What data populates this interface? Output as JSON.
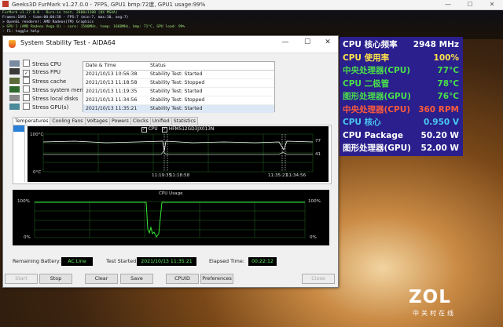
{
  "furmark": {
    "title": "Geeks3D FurMark v1.27.0.0 - 7FPS, GPU1 bmp:72度, GPU1 usage:99%",
    "controls": [
      "—",
      "☐",
      "✕"
    ],
    "osd": [
      "FurMark v1.27.0.0 - Burn-in test, 2800x1100 (8X MSAA)",
      "Frames:1891 - time:00:04:58 - FPS:7 (min:7, max:10, avg:7)",
      "> OpenGL renderer: AMD Radeon(TM) Graphics",
      "> GPU 1 (AMD Radeon Vega 8) - core: 1500MHz, temp: 1668MHz, bmp: 71°C, GPU load: 99%",
      "- F1: toggle help"
    ]
  },
  "aida": {
    "title": "System Stability Test - AIDA64",
    "window_controls": [
      "—",
      "☐",
      "✕"
    ],
    "stress_options": [
      {
        "label": "Stress CPU",
        "checked": false
      },
      {
        "label": "Stress FPU",
        "checked": true
      },
      {
        "label": "Stress cache",
        "checked": false
      },
      {
        "label": "Stress system memory",
        "checked": false
      },
      {
        "label": "Stress local disks",
        "checked": false
      },
      {
        "label": "Stress GPU(s)",
        "checked": false
      }
    ],
    "log": {
      "headers": [
        "Date & Time",
        "Status"
      ],
      "rows": [
        [
          "2021/10/13 10:56:38",
          "Stability Test: Started"
        ],
        [
          "2021/10/13 11:18:58",
          "Stability Test: Stopped"
        ],
        [
          "2021/10/13 11:19:35",
          "Stability Test: Started"
        ],
        [
          "2021/10/13 11:34:56",
          "Stability Test: Stopped"
        ],
        [
          "2021/10/13 11:35:21",
          "Stability Test: Started"
        ]
      ]
    },
    "tabs": [
      "Temperatures",
      "Cooling Fans",
      "Voltages",
      "Powers",
      "Clocks",
      "Unified",
      "Statistics"
    ],
    "active_tab": "Temperatures",
    "temp_chart": {
      "legend": [
        "CPU",
        "HFM512GD3JX013N"
      ],
      "y_top": "100°C",
      "y_bottom": "0°C",
      "time_labels": [
        "11:19:35",
        "11:18:58",
        "11:35:21",
        "11:34:56"
      ],
      "readout_values": [
        "77",
        "41"
      ]
    },
    "usage_chart": {
      "title": "CPU Usage",
      "y_top": "100%",
      "y_bottom": "0%",
      "right_top": "100%",
      "right_bottom": "0%"
    },
    "status": {
      "battery_label": "Remaining Battery:",
      "battery_value": "AC Line",
      "started_label": "Test Started:",
      "started_value": "2021/10/13 11:35:21",
      "elapsed_label": "Elapsed Time:",
      "elapsed_value": "00:22:12"
    },
    "buttons": {
      "start": "Start",
      "stop": "Stop",
      "clear": "Clear",
      "save": "Save",
      "cpuid": "CPUID",
      "preferences": "Preferences",
      "close": "Close"
    }
  },
  "hwinfo": [
    {
      "label": "CPU 核心频率",
      "value": "2948 MHz",
      "color": "#ffffff"
    },
    {
      "label": "CPU 使用率",
      "value": "100%",
      "color": "#ffe14a"
    },
    {
      "label": "中央处理器(CPU)",
      "value": "77°C",
      "color": "#4ae04a"
    },
    {
      "label": "CPU 二极管",
      "value": "78°C",
      "color": "#4ae04a"
    },
    {
      "label": "图形处理器(GPU)",
      "value": "76°C",
      "color": "#4ae04a"
    },
    {
      "label": "中央处理器(CPU)",
      "value": "360 RPM",
      "color": "#ff5a3c"
    },
    {
      "label": "CPU 核心",
      "value": "0.950 V",
      "color": "#48c8f0"
    },
    {
      "label": "CPU Package",
      "value": "50.20 W",
      "color": "#ffffff"
    },
    {
      "label": "图形处理器(GPU)",
      "value": "52.00 W",
      "color": "#ffffff"
    }
  ],
  "watermark": {
    "logo": "ZOL",
    "sub": "中关村在线"
  }
}
